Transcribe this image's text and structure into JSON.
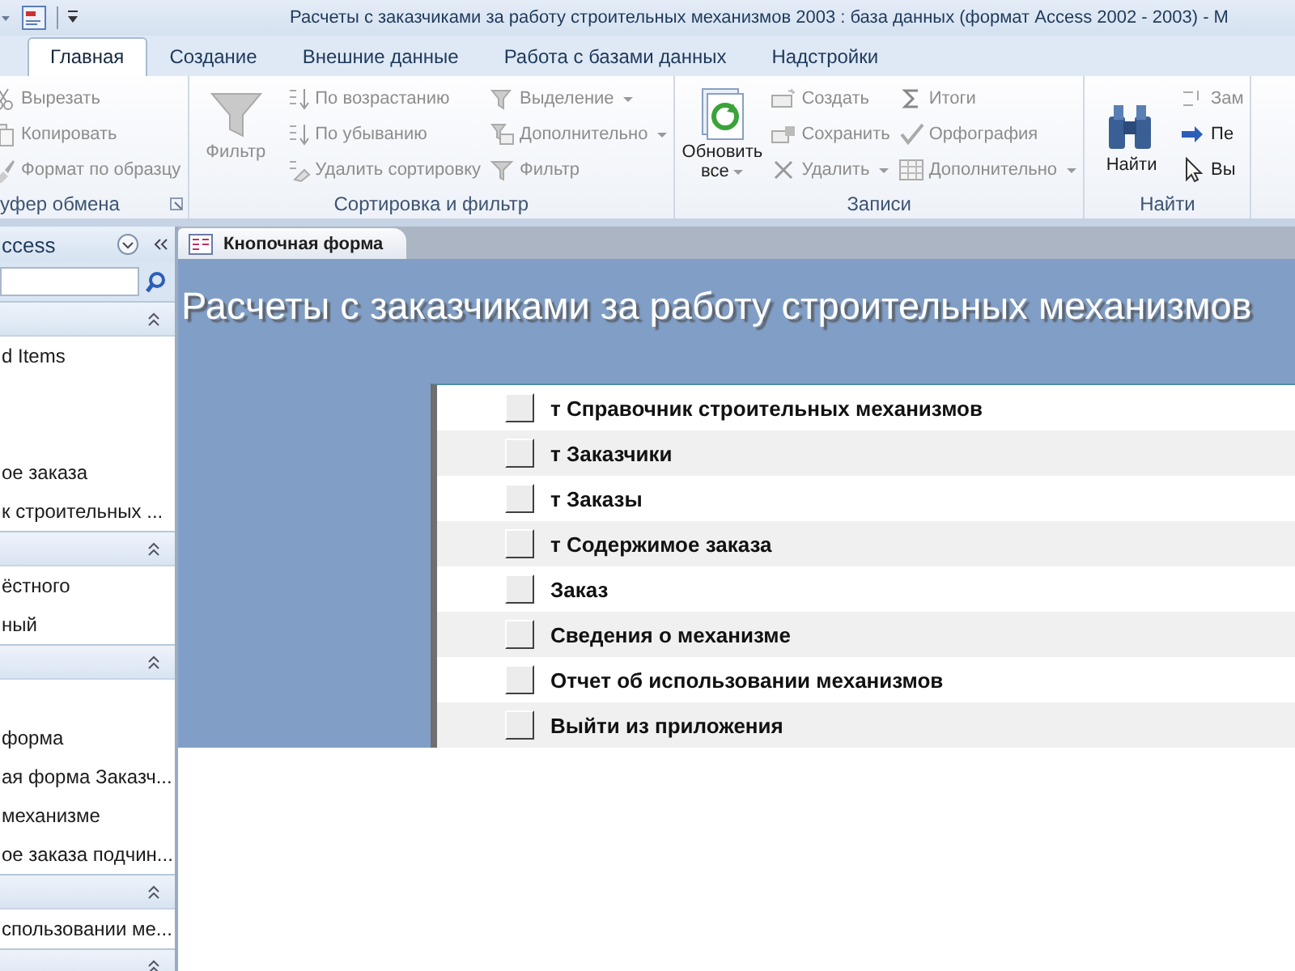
{
  "window": {
    "title": "Расчеты с заказчиками за работу строительных механизмов 2003 : база данных (формат Access 2002 - 2003)  -  M"
  },
  "tabs": [
    {
      "label": "Главная",
      "selected": true
    },
    {
      "label": "Создание",
      "selected": false
    },
    {
      "label": "Внешние данные",
      "selected": false
    },
    {
      "label": "Работа с базами данных",
      "selected": false
    },
    {
      "label": "Надстройки",
      "selected": false
    }
  ],
  "ribbon": [
    {
      "label": "уфер обмена",
      "launcher": true,
      "columns": [
        {
          "kind": "small",
          "items": [
            {
              "label": "Вырезать",
              "disabled": true,
              "dropdown": false
            },
            {
              "label": "Копировать",
              "disabled": true,
              "dropdown": false
            },
            {
              "label": "Формат по образцу",
              "disabled": true,
              "dropdown": false
            }
          ]
        }
      ]
    },
    {
      "label": "Сортировка и фильтр",
      "launcher": false,
      "columns": [
        {
          "kind": "large",
          "label": "Фильтр",
          "disabled": true,
          "dropdown": false
        },
        {
          "kind": "small",
          "items": [
            {
              "label": "По возрастанию",
              "disabled": true,
              "dropdown": false
            },
            {
              "label": "По убыванию",
              "disabled": true,
              "dropdown": false
            },
            {
              "label": "Удалить сортировку",
              "disabled": true,
              "dropdown": false
            }
          ]
        },
        {
          "kind": "small",
          "items": [
            {
              "label": "Выделение",
              "disabled": true,
              "dropdown": true
            },
            {
              "label": "Дополнительно",
              "disabled": true,
              "dropdown": true
            },
            {
              "label": "Фильтр",
              "disabled": true,
              "dropdown": false
            }
          ]
        }
      ]
    },
    {
      "label": "Записи",
      "launcher": false,
      "columns": [
        {
          "kind": "large",
          "label": "Обновить все",
          "disabled": false,
          "dropdown": true
        },
        {
          "kind": "small",
          "items": [
            {
              "label": "Создать",
              "disabled": true,
              "dropdown": false
            },
            {
              "label": "Сохранить",
              "disabled": true,
              "dropdown": false
            },
            {
              "label": "Удалить",
              "disabled": true,
              "dropdown": true
            }
          ]
        },
        {
          "kind": "small",
          "items": [
            {
              "label": "Итоги",
              "disabled": true,
              "dropdown": false
            },
            {
              "label": "Орфография",
              "disabled": true,
              "dropdown": false
            },
            {
              "label": "Дополнительно",
              "disabled": true,
              "dropdown": true
            }
          ]
        }
      ]
    },
    {
      "label": "Найти",
      "launcher": false,
      "columns": [
        {
          "kind": "large",
          "label": "Найти",
          "disabled": false,
          "dropdown": false
        },
        {
          "kind": "small",
          "items": [
            {
              "label": "Зам",
              "disabled": true,
              "dropdown": false
            },
            {
              "label": "Пе",
              "disabled": false,
              "dropdown": false
            },
            {
              "label": "Вы",
              "disabled": false,
              "dropdown": false
            }
          ]
        }
      ]
    }
  ],
  "nav_pane": {
    "title": "ccess",
    "groups": [
      {
        "expanded": true,
        "items": [
          {
            "kind": "item",
            "label": "d Items"
          },
          {
            "kind": "blank"
          },
          {
            "kind": "blank"
          },
          {
            "kind": "item",
            "label": "ое заказа"
          },
          {
            "kind": "item",
            "label": "к строительных ..."
          }
        ]
      },
      {
        "expanded": true,
        "items": [
          {
            "kind": "item",
            "label": "ёстного"
          },
          {
            "kind": "item",
            "label": "ный"
          }
        ]
      },
      {
        "expanded": true,
        "items": [
          {
            "kind": "blank"
          },
          {
            "kind": "item",
            "label": "форма"
          },
          {
            "kind": "item",
            "label": "ая форма Заказч..."
          },
          {
            "kind": "item",
            "label": "механизме"
          },
          {
            "kind": "item",
            "label": "ое заказа подчин..."
          }
        ]
      },
      {
        "expanded": true,
        "items": [
          {
            "kind": "item",
            "label": "спользовании ме..."
          }
        ]
      },
      {
        "expanded": true
      }
    ]
  },
  "document_tab": {
    "label": "Кнопочная форма"
  },
  "form": {
    "title": "Расчеты с заказчиками за работу строительных механизмов",
    "buttons": [
      "т Справочник строительных механизмов",
      "т Заказчики",
      "т Заказы",
      "т Содержимое заказа",
      "Заказ",
      "Сведения о механизме",
      "Отчет об использовании механизмов",
      "Выйти из приложения"
    ]
  }
}
